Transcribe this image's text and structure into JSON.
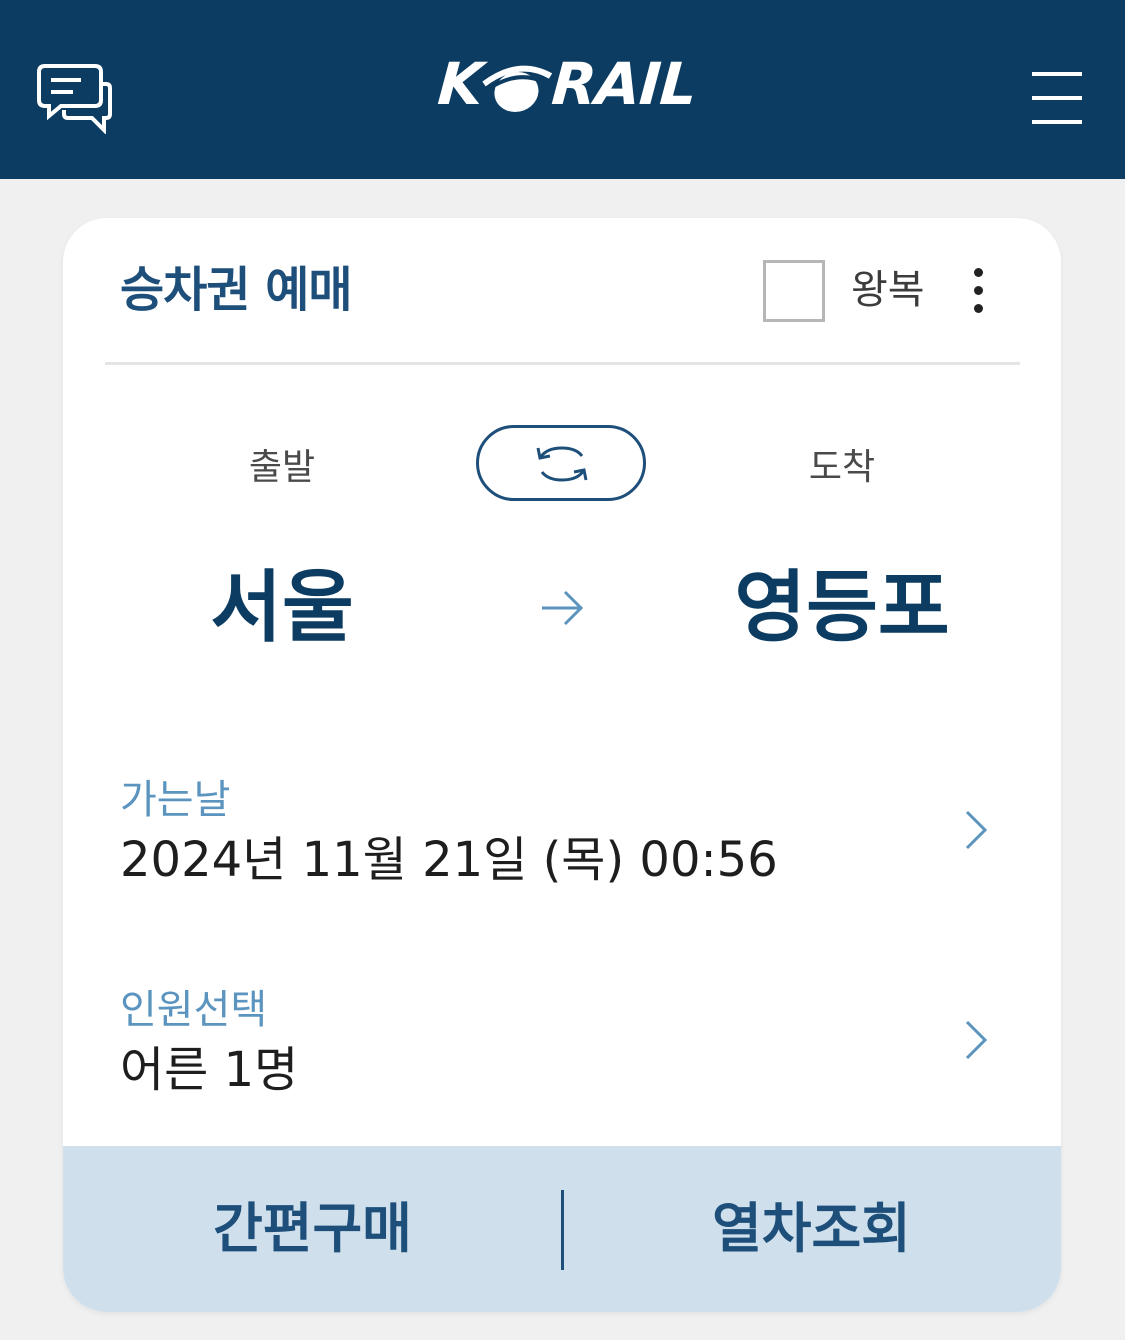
{
  "header": {
    "brand": "KORAIL",
    "brand_before_o": "K",
    "brand_after_o": "RAIL",
    "background_color": "#0c3c61"
  },
  "card": {
    "title": "승차권 예매",
    "round_trip_label": "왕복",
    "round_trip_checked": false,
    "departure_label": "출발",
    "arrival_label": "도착",
    "departure_station": "서울",
    "arrival_station": "영등포",
    "date_label": "가는날",
    "date_value": "2024년 11월 21일 (목) 00:56",
    "passenger_label": "인원선택",
    "passenger_value": "어른 1명"
  },
  "footer": {
    "quick_purchase_label": "간편구매",
    "train_search_label": "열차조회"
  },
  "colors": {
    "primary": "#0c3c61",
    "accent": "#1e4f7a",
    "label_blue": "#5b94be",
    "footer_bg": "#cfe0ec"
  },
  "icons": {
    "chat": "chat-bubbles-icon",
    "menu": "hamburger-menu-icon",
    "more": "more-vertical-icon",
    "swap": "swap-icon",
    "direction": "arrow-right-icon",
    "chevron": "chevron-right-icon"
  }
}
